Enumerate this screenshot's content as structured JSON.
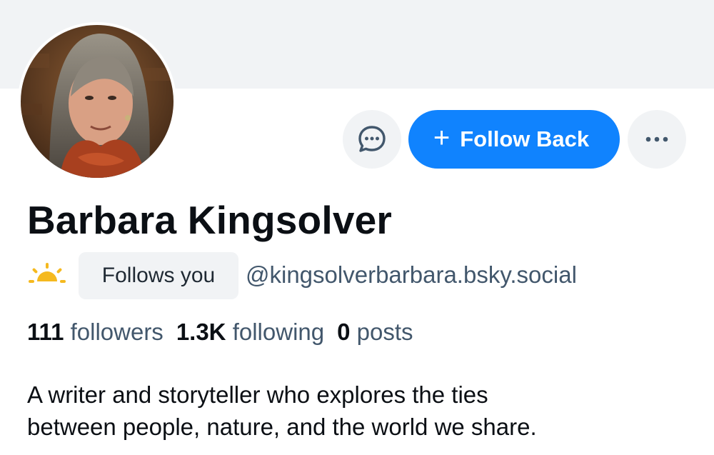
{
  "profile": {
    "display_name": "Barbara Kingsolver",
    "handle": "@kingsolverbarbara.bsky.social",
    "follows_you": "Follows you",
    "bio_line1": "A writer and storyteller who explores the ties",
    "bio_line2": "between people, nature, and the world we share."
  },
  "actions": {
    "follow_back_label": "Follow Back",
    "follow_icon": "plus-icon",
    "message_icon": "chat-bubble-icon",
    "more_icon": "ellipsis-icon"
  },
  "stats": {
    "followers_count": "111",
    "followers_label": "followers",
    "following_count": "1.3K",
    "following_label": "following",
    "posts_count": "0",
    "posts_label": "posts"
  },
  "colors": {
    "accent": "#1083fe",
    "banner": "#f1f3f5",
    "sun": "#f5b91f"
  }
}
